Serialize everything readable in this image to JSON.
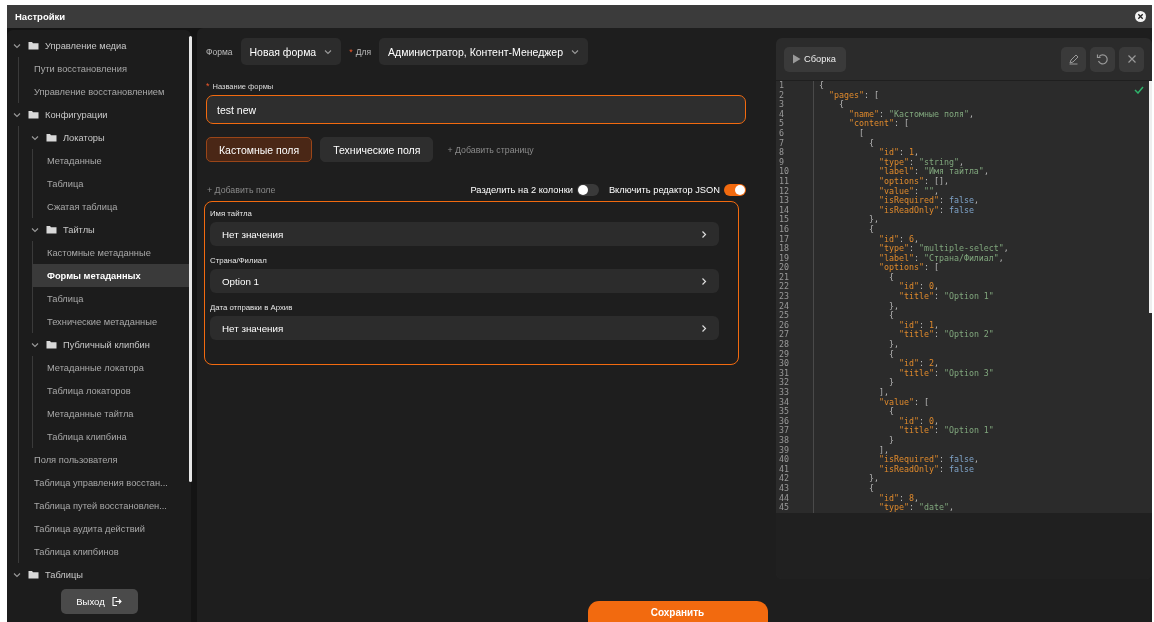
{
  "window": {
    "title": "Настройки"
  },
  "sidebar": {
    "items": [
      {
        "kind": "folder",
        "label": "Управление медиа",
        "expanded": true,
        "selected": false,
        "children": [
          {
            "kind": "page",
            "label": "Пути восстановления",
            "selected": false
          },
          {
            "kind": "page",
            "label": "Управление восстановлением",
            "selected": false
          }
        ]
      },
      {
        "kind": "folder",
        "label": "Конфигурации",
        "expanded": true,
        "selected": false,
        "children": [
          {
            "kind": "folder",
            "label": "Локаторы",
            "expanded": true,
            "selected": false,
            "children": [
              {
                "kind": "page",
                "label": "Метаданные",
                "selected": false
              },
              {
                "kind": "page",
                "label": "Таблица",
                "selected": false
              },
              {
                "kind": "page",
                "label": "Сжатая таблица",
                "selected": false
              }
            ]
          },
          {
            "kind": "folder",
            "label": "Тайтлы",
            "expanded": true,
            "selected": false,
            "children": [
              {
                "kind": "page",
                "label": "Кастомные метаданные",
                "selected": false
              },
              {
                "kind": "page",
                "label": "Формы метаданных",
                "selected": true
              },
              {
                "kind": "page",
                "label": "Таблица",
                "selected": false
              },
              {
                "kind": "page",
                "label": "Технические метаданные",
                "selected": false
              }
            ]
          },
          {
            "kind": "folder",
            "label": "Публичный клипбин",
            "expanded": true,
            "selected": false,
            "children": [
              {
                "kind": "page",
                "label": "Метаданные локатора",
                "selected": false
              },
              {
                "kind": "page",
                "label": "Таблица локаторов",
                "selected": false
              },
              {
                "kind": "page",
                "label": "Метаданные тайтла",
                "selected": false
              },
              {
                "kind": "page",
                "label": "Таблица клипбина",
                "selected": false
              }
            ]
          },
          {
            "kind": "page",
            "label": "Поля пользователя",
            "selected": false
          },
          {
            "kind": "page",
            "label": "Таблица управления восстан...",
            "selected": false
          },
          {
            "kind": "page",
            "label": "Таблица путей восстановлен...",
            "selected": false
          },
          {
            "kind": "page",
            "label": "Таблица аудита действий",
            "selected": false
          },
          {
            "kind": "page",
            "label": "Таблица клипбинов",
            "selected": false
          }
        ]
      },
      {
        "kind": "folder",
        "label": "Таблицы",
        "expanded": true,
        "selected": false
      }
    ],
    "logout_button": "Выход"
  },
  "form": {
    "form_label": "Форма",
    "form_select": "Новая форма",
    "for_required_mark": "*",
    "for_label": "Для",
    "for_select": "Администратор, Контент-Менеджер",
    "name_required_mark": "*",
    "name_label": "Название формы",
    "name_value": "test new"
  },
  "tabs": [
    {
      "label": "Кастомные поля",
      "selected": true
    },
    {
      "label": "Технические поля",
      "selected": false
    }
  ],
  "add_page": "+ Добавить страницу",
  "add_field": "+ Добавить поле",
  "toggles": [
    {
      "label": "Разделить на 2 колонки",
      "on": false
    },
    {
      "label": "Включить редактор JSON",
      "on": true
    }
  ],
  "fields": [
    {
      "label": "Имя тайтла",
      "value": "Нет значения"
    },
    {
      "label": "Страна/Филиал",
      "value": "Option 1"
    },
    {
      "label": "Дата отправки в Архив",
      "value": "Нет значения"
    }
  ],
  "editor": {
    "build_button": "Сборка",
    "valid": true,
    "lines": [
      {
        "n": "1",
        "code": "{"
      },
      {
        "n": "2",
        "code": "  \"pages\": ["
      },
      {
        "n": "3",
        "code": "    {"
      },
      {
        "n": "4",
        "code": "      \"name\": \"Кастомные поля\","
      },
      {
        "n": "5",
        "code": "      \"content\": ["
      },
      {
        "n": "6",
        "code": "        ["
      },
      {
        "n": "7",
        "code": "          {"
      },
      {
        "n": "8",
        "code": "            \"id\": 1,"
      },
      {
        "n": "9",
        "code": "            \"type\": \"string\","
      },
      {
        "n": "10",
        "code": "            \"label\": \"Имя тайтла\","
      },
      {
        "n": "11",
        "code": "            \"options\": [],"
      },
      {
        "n": "12",
        "code": "            \"value\": \"\","
      },
      {
        "n": "13",
        "code": "            \"isRequired\": false,"
      },
      {
        "n": "14",
        "code": "            \"isReadOnly\": false"
      },
      {
        "n": "15",
        "code": "          },"
      },
      {
        "n": "16",
        "code": "          {"
      },
      {
        "n": "17",
        "code": "            \"id\": 6,"
      },
      {
        "n": "18",
        "code": "            \"type\": \"multiple-select\","
      },
      {
        "n": "19",
        "code": "            \"label\": \"Страна/Филиал\","
      },
      {
        "n": "20",
        "code": "            \"options\": ["
      },
      {
        "n": "21",
        "code": "              {"
      },
      {
        "n": "22",
        "code": "                \"id\": 0,"
      },
      {
        "n": "23",
        "code": "                \"title\": \"Option 1\""
      },
      {
        "n": "24",
        "code": "              },"
      },
      {
        "n": "25",
        "code": "              {"
      },
      {
        "n": "26",
        "code": "                \"id\": 1,"
      },
      {
        "n": "27",
        "code": "                \"title\": \"Option 2\""
      },
      {
        "n": "28",
        "code": "              },"
      },
      {
        "n": "29",
        "code": "              {"
      },
      {
        "n": "30",
        "code": "                \"id\": 2,"
      },
      {
        "n": "31",
        "code": "                \"title\": \"Option 3\""
      },
      {
        "n": "32",
        "code": "              }"
      },
      {
        "n": "33",
        "code": "            ],"
      },
      {
        "n": "34",
        "code": "            \"value\": ["
      },
      {
        "n": "35",
        "code": "              {"
      },
      {
        "n": "36",
        "code": "                \"id\": 0,"
      },
      {
        "n": "37",
        "code": "                \"title\": \"Option 1\""
      },
      {
        "n": "38",
        "code": "              }"
      },
      {
        "n": "39",
        "code": "            ],"
      },
      {
        "n": "40",
        "code": "            \"isRequired\": false,"
      },
      {
        "n": "41",
        "code": "            \"isReadOnly\": false"
      },
      {
        "n": "42",
        "code": "          },"
      },
      {
        "n": "43",
        "code": "          {"
      },
      {
        "n": "44",
        "code": "            \"id\": 8,"
      },
      {
        "n": "45",
        "code": "            \"type\": \"date\","
      }
    ]
  },
  "save_button": "Сохранить"
}
